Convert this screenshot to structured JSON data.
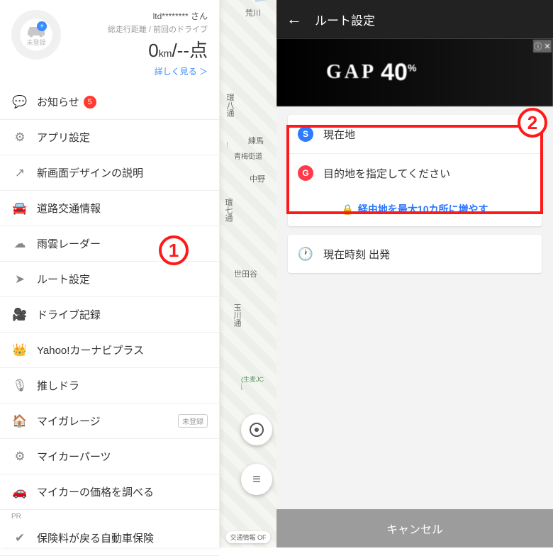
{
  "profile": {
    "username": "ltd******** さん",
    "sublabel": "総走行距離  /  前回のドライブ",
    "km_value": "0",
    "km_unit": "km",
    "points": "--点",
    "avatar_label": "未登録",
    "detail_link": "詳しく見る  ＞"
  },
  "menu": [
    {
      "icon": "💬",
      "label": "お知らせ",
      "badge": "5"
    },
    {
      "icon": "⚙",
      "label": "アプリ設定"
    },
    {
      "icon": "↗",
      "label": "新画面デザインの説明"
    },
    {
      "icon": "🚘",
      "label": "道路交通情報"
    },
    {
      "icon": "☁",
      "label": "雨雲レーダー"
    },
    {
      "icon": "➤",
      "label": "ルート設定"
    },
    {
      "icon": "🎥",
      "label": "ドライブ記録"
    },
    {
      "icon": "👑",
      "label": "Yahoo!カーナビプラス"
    },
    {
      "icon": "🎙",
      "label": "推しドラ"
    },
    {
      "icon": "🏠",
      "label": "マイガレージ",
      "tag": "未登録"
    },
    {
      "icon": "⚙",
      "label": "マイカーパーツ"
    },
    {
      "icon": "🚗",
      "label": "マイカーの価格を調べる"
    },
    {
      "icon": "✔",
      "label": "保険料が戻る自動車保険"
    }
  ],
  "pr_label": "PR",
  "map_labels": {
    "a": "荒川",
    "b": "環八通",
    "c": "練馬",
    "d": "青梅街道",
    "e": "中野",
    "f": "環七通",
    "g": "世田谷",
    "h": "玉川通",
    "i": "(生麦JC"
  },
  "map_traffic_chip": "交通情報 OF",
  "route": {
    "title": "ルート設定",
    "start": "現在地",
    "goal": "目的地を指定してください",
    "waypoints": "経由地を最大10カ所に増やす",
    "time": "現在時刻 出発",
    "cancel": "キャンセル",
    "start_pin": "S",
    "goal_pin": "G"
  },
  "ad": {
    "logo": "GAP",
    "num": "40",
    "sup": "%"
  },
  "annot": {
    "one": "1",
    "two": "2"
  }
}
